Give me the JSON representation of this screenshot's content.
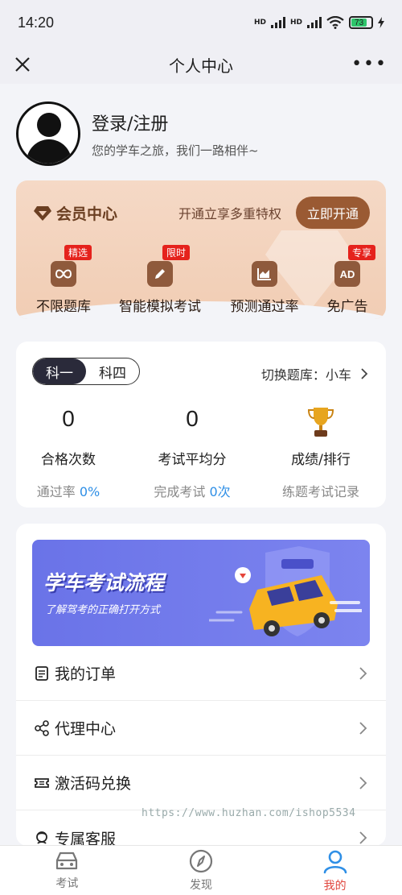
{
  "statusbar": {
    "time": "14:20",
    "net1": "HD",
    "net2": "HD",
    "battery": "73"
  },
  "navbar": {
    "title": "个人中心"
  },
  "profile": {
    "login": "登录/注册",
    "subtitle": "您的学车之旅，我们一路相伴~"
  },
  "vip": {
    "title": "会员中心",
    "desc": "开通立享多重特权",
    "button": "立即开通",
    "features": [
      {
        "label": "不限题库",
        "tag": "精选",
        "icon": "infinity-icon"
      },
      {
        "label": "智能模拟考试",
        "tag": "限时",
        "icon": "pencil-icon"
      },
      {
        "label": "预测通过率",
        "tag": "",
        "icon": "chart-icon"
      },
      {
        "label": "免广告",
        "tag": "专享",
        "icon": "ad-icon",
        "glyph": "AD"
      }
    ]
  },
  "stats": {
    "subjects": [
      "科一",
      "科四"
    ],
    "switch": "切换题库：小车",
    "items": [
      {
        "value": "0",
        "label": "合格次数",
        "foot": "通过率",
        "foot_value": "0%"
      },
      {
        "value": "0",
        "label": "考试平均分",
        "foot": "完成考试",
        "foot_value": "0次"
      },
      {
        "label": "成绩/排行",
        "foot": "练题考试记录"
      }
    ]
  },
  "banner": {
    "title": "学车考试流程",
    "subtitle": "了解驾考的正确打开方式"
  },
  "menu": [
    {
      "label": "我的订单",
      "icon": "order-icon"
    },
    {
      "label": "代理中心",
      "icon": "share-icon"
    },
    {
      "label": "激活码兑换",
      "icon": "ticket-icon"
    },
    {
      "label": "专属客服",
      "icon": "service-icon"
    }
  ],
  "watermark": "https://www.huzhan.com/ishop5534",
  "tabbar": [
    {
      "label": "考试",
      "icon": "car-icon"
    },
    {
      "label": "发现",
      "icon": "compass-icon"
    },
    {
      "label": "我的",
      "icon": "user-icon"
    }
  ],
  "colors": {
    "accent": "#e0463d",
    "vip_button": "#9a5a33",
    "blue": "#2f8fe6",
    "tag_red": "#e5221c"
  }
}
